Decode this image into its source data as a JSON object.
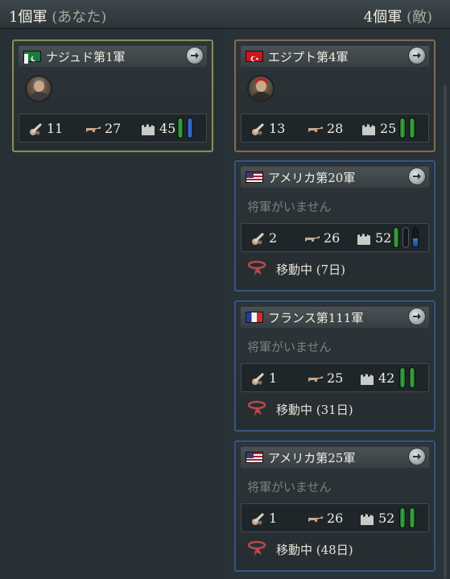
{
  "header": {
    "own_count": "1個軍",
    "own_label": "(あなた)",
    "enemy_count": "4個軍",
    "enemy_label": "(敵)"
  },
  "own_armies": [
    {
      "name": "ナジュド第1軍",
      "flag_icon": "nejd-flag-icon",
      "general": "portrait",
      "stats": {
        "artillery": "11",
        "infantry": "27",
        "fortification": "45"
      },
      "bars": [
        "green",
        "blue"
      ]
    }
  ],
  "enemy_armies": [
    {
      "name": "エジプト第4軍",
      "flag_icon": "egypt-flag-icon",
      "general": "portrait",
      "stats": {
        "artillery": "13",
        "infantry": "28",
        "fortification": "25"
      },
      "bars": [
        "green",
        "green"
      ]
    },
    {
      "name": "アメリカ第20軍",
      "flag_icon": "usa-flag-icon",
      "no_general": "将軍がいません",
      "stats": {
        "artillery": "2",
        "infantry": "26",
        "fortification": "52"
      },
      "bars": [
        "green",
        "empty",
        "blue-partial"
      ],
      "status": "移動中 (7日)"
    },
    {
      "name": "フランス第111軍",
      "flag_icon": "france-flag-icon",
      "no_general": "将軍がいません",
      "stats": {
        "artillery": "1",
        "infantry": "25",
        "fortification": "42"
      },
      "bars": [
        "green",
        "green"
      ],
      "status": "移動中 (31日)"
    },
    {
      "name": "アメリカ第25軍",
      "flag_icon": "usa-flag-icon",
      "no_general": "将軍がいません",
      "stats": {
        "artillery": "1",
        "infantry": "26",
        "fortification": "52"
      },
      "bars": [
        "green",
        "green"
      ],
      "status": "移動中 (48日)"
    }
  ],
  "colors": {
    "own_border": "#8a8a58",
    "egypt_border": "#7f6a55",
    "moving_border": "#37557d",
    "text": "#f1ede0",
    "muted": "#7d817b"
  }
}
